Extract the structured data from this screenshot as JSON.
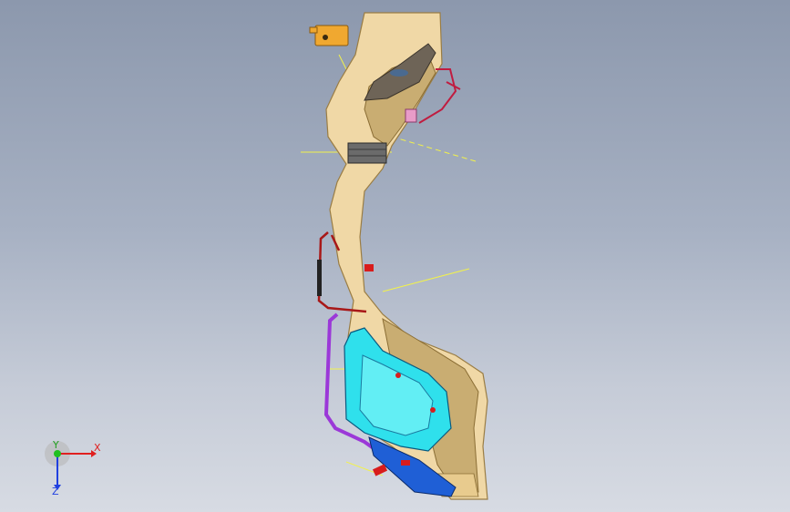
{
  "viewport": {
    "background_top": "#8c98ad",
    "background_bottom": "#d7dbe3"
  },
  "model": {
    "colors": {
      "main_body": "#f0d8a6",
      "main_body_shadow": "#c9ad72",
      "dark_pocket": "#6e6457",
      "cyan_panel": "#2fe0ec",
      "blue_part": "#1f5fd6",
      "purple_pipe": "#9b38d8",
      "red_accent": "#d81c1c",
      "orange_bracket": "#f0a830",
      "gray_block": "#6b6b6b",
      "yellow_lines": "#f2f24a"
    }
  },
  "triad": {
    "x_label": "X",
    "y_label": "Y",
    "z_label": "Z",
    "x_color": "#e02020",
    "y_color": "#20c020",
    "z_color": "#2040e0"
  }
}
